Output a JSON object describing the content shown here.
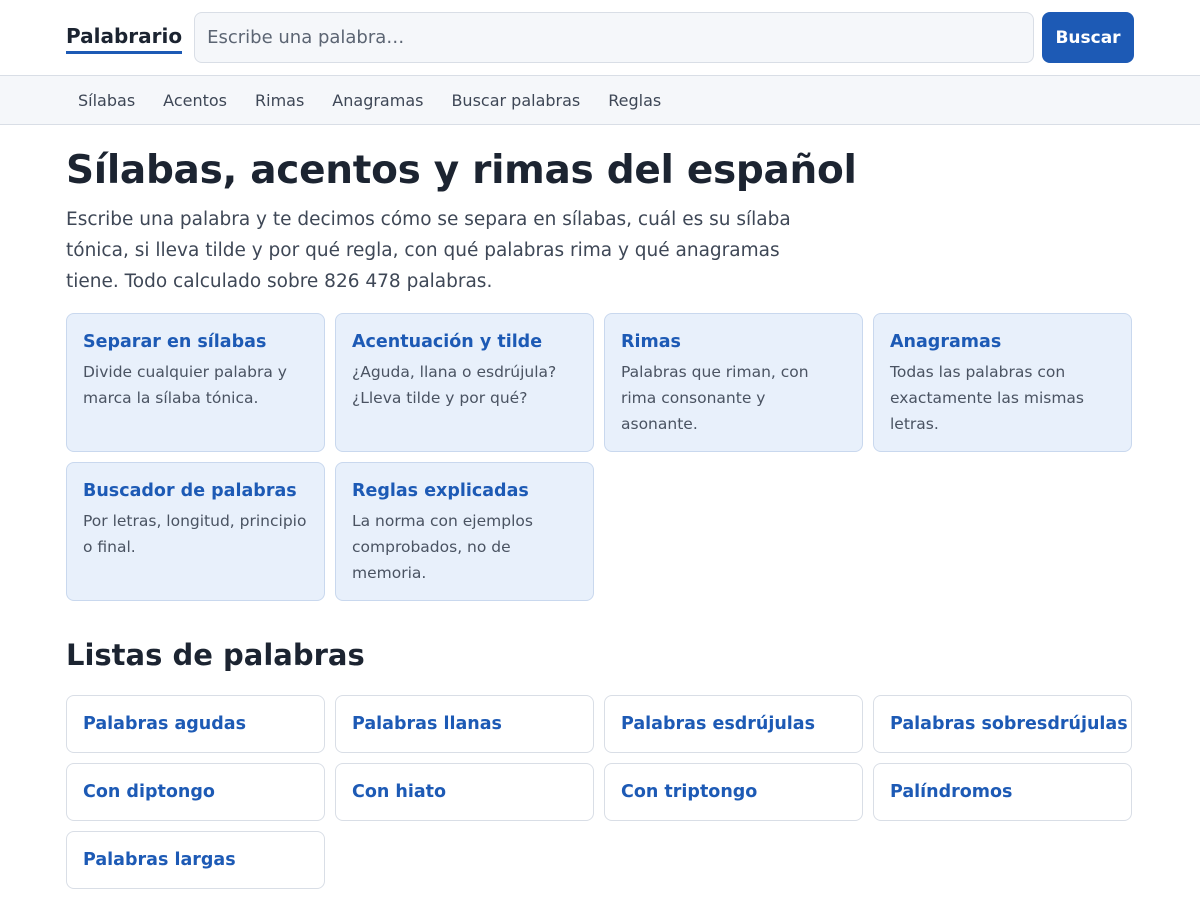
{
  "header": {
    "brand": "Palabrario",
    "search_placeholder": "Escribe una palabra…",
    "search_button": "Buscar"
  },
  "nav": {
    "items": [
      "Sílabas",
      "Acentos",
      "Rimas",
      "Anagramas",
      "Buscar palabras",
      "Reglas"
    ]
  },
  "main": {
    "title": "Sílabas, acentos y rimas del español",
    "intro": "Escribe una palabra y te decimos cómo se separa en sílabas, cuál es su sílaba tónica, si lleva tilde y por qué regla, con qué palabras rima y qué anagramas tiene. Todo calculado sobre 826 478 palabras."
  },
  "features": [
    {
      "title": "Separar en sílabas",
      "desc": "Divide cualquier palabra y marca la sílaba tónica."
    },
    {
      "title": "Acentuación y tilde",
      "desc": "¿Aguda, llana o esdrújula? ¿Lleva tilde y por qué?"
    },
    {
      "title": "Rimas",
      "desc": "Palabras que riman, con rima consonante y asonante."
    },
    {
      "title": "Anagramas",
      "desc": "Todas las palabras con exactamente las mismas letras."
    },
    {
      "title": "Buscador de palabras",
      "desc": "Por letras, longitud, principio o final."
    },
    {
      "title": "Reglas explicadas",
      "desc": "La norma con ejemplos comprobados, no de memoria."
    }
  ],
  "lists": {
    "heading": "Listas de palabras",
    "items": [
      "Palabras agudas",
      "Palabras llanas",
      "Palabras esdrújulas",
      "Palabras sobresdrújulas",
      "Con diptongo",
      "Con hiato",
      "Con triptongo",
      "Palíndromos",
      "Palabras largas"
    ]
  },
  "colors": {
    "accent": "#1d5ab5",
    "card_bg": "#e8f0fb",
    "text": "#1c2431"
  }
}
